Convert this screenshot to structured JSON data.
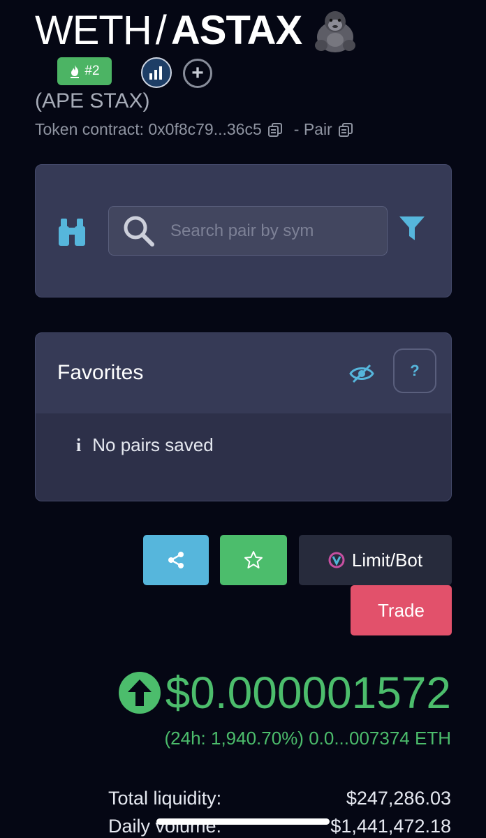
{
  "header": {
    "base_symbol": "WETH",
    "separator": "/",
    "quote_symbol": "ASTAX",
    "icon": "gorilla-emoji-icon",
    "rank_badge": "#2",
    "token_full_name": "(APE STAX)",
    "contract_label": "Token contract: 0x0f8c79...36c5",
    "pair_label": "- Pair"
  },
  "search": {
    "placeholder": "Search pair by sym",
    "value": ""
  },
  "favorites": {
    "title": "Favorites",
    "help_label": "?",
    "empty_text": "No pairs saved"
  },
  "actions": {
    "limit_bot_label": "Limit/Bot",
    "trade_label": "Trade"
  },
  "price": {
    "usd": "$0.000001572",
    "change_line": "(24h: 1,940.70%) 0.0...007374 ETH",
    "direction": "up"
  },
  "stats": {
    "liquidity_label": "Total liquidity:",
    "liquidity_value": "$247,286.03",
    "volume_label": "Daily volume:",
    "volume_value": "$1,441,472.18"
  },
  "colors": {
    "background": "#050714",
    "card": "#363a56",
    "green": "#4cbd6c",
    "blue": "#56b6dc",
    "red": "#e2516b"
  }
}
